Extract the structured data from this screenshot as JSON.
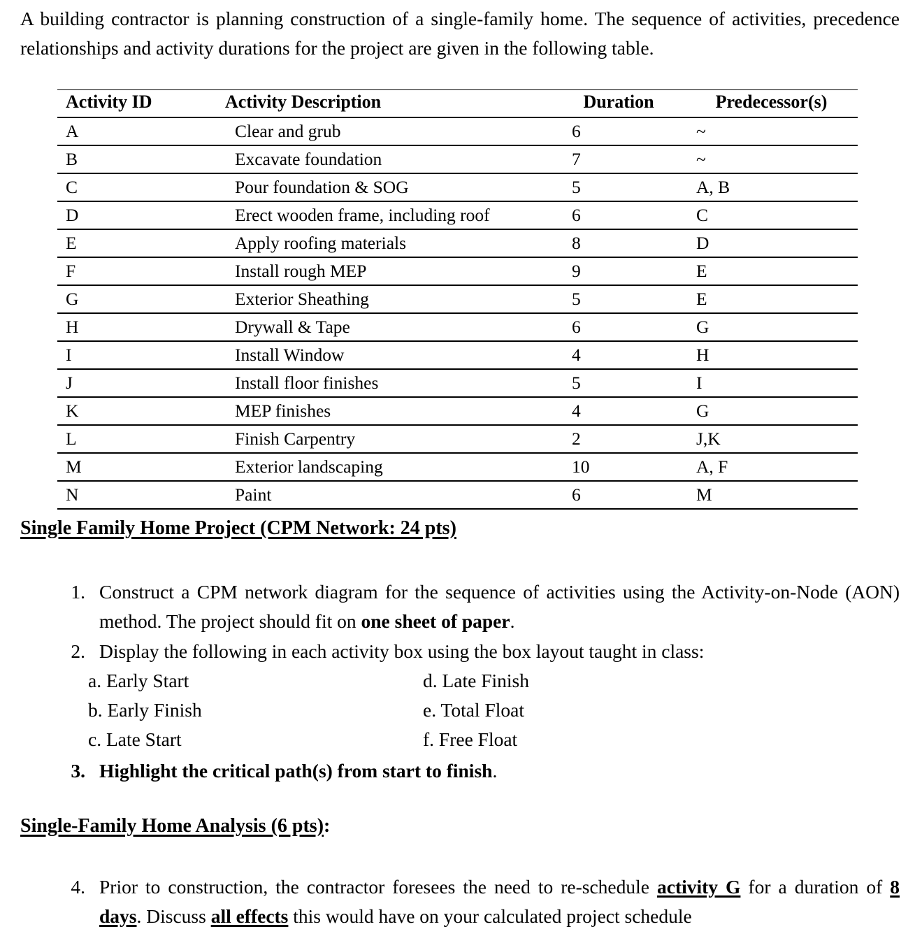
{
  "intro": {
    "paragraph": "A building contractor is planning construction of a single-family home.  The sequence of activities, precedence relationships and activity durations for the project are given in the following table."
  },
  "table": {
    "headers": {
      "id": "Activity ID",
      "description": "Activity Description",
      "duration": "Duration",
      "predecessors": "Predecessor(s)"
    },
    "rows": [
      {
        "id": "A",
        "description": "Clear and grub",
        "duration": "6",
        "predecessors": "~"
      },
      {
        "id": "B",
        "description": "Excavate foundation",
        "duration": "7",
        "predecessors": "~"
      },
      {
        "id": "C",
        "description": "Pour foundation & SOG",
        "duration": "5",
        "predecessors": "A, B"
      },
      {
        "id": "D",
        "description": "Erect wooden frame, including roof",
        "duration": "6",
        "predecessors": "C"
      },
      {
        "id": "E",
        "description": "Apply roofing materials",
        "duration": "8",
        "predecessors": "D"
      },
      {
        "id": "F",
        "description": "Install rough MEP",
        "duration": "9",
        "predecessors": "E"
      },
      {
        "id": "G",
        "description": "Exterior Sheathing",
        "duration": "5",
        "predecessors": "E"
      },
      {
        "id": "H",
        "description": "Drywall & Tape",
        "duration": "6",
        "predecessors": "G"
      },
      {
        "id": "I",
        "description": "Install Window",
        "duration": "4",
        "predecessors": "H"
      },
      {
        "id": "J",
        "description": "Install floor finishes",
        "duration": "5",
        "predecessors": "I"
      },
      {
        "id": "K",
        "description": "MEP finishes",
        "duration": "4",
        "predecessors": "G"
      },
      {
        "id": "L",
        "description": "Finish Carpentry",
        "duration": "2",
        "predecessors": "J,K"
      },
      {
        "id": "M",
        "description": "Exterior landscaping",
        "duration": "10",
        "predecessors": "A, F"
      },
      {
        "id": "N",
        "description": "Paint",
        "duration": "6",
        "predecessors": "M"
      }
    ]
  },
  "sections": {
    "project_heading": "Single Family Home Project (CPM Network: 24 pts)",
    "analysis_heading": "Single-Family Home Analysis (6 pts)",
    "analysis_heading_suffix": ":"
  },
  "items": {
    "item1": {
      "number": "1.",
      "text_a": "Construct a CPM network diagram for the sequence of activities using the Activity-on-Node (AON) method.  The project should fit on ",
      "bold_b": "one sheet of paper",
      "text_c": "."
    },
    "item2": {
      "number": "2.",
      "text": "Display the following in each activity box using the box layout taught in class:"
    },
    "item3": {
      "number": "3.",
      "bold_text": "Highlight the critical path(s) from start to finish",
      "text_end": "."
    },
    "item4": {
      "number": "4.",
      "text_a": "Prior to construction, the contractor foresees the need to re-schedule ",
      "bold_b": "activity G",
      "text_c": " for a duration of ",
      "bold_d": "8 days",
      "text_e": ".  Discuss ",
      "bold_f": "all effects",
      "text_g": " this would have on your calculated project schedule"
    }
  },
  "sublist": [
    {
      "left": "a. Early Start",
      "right": "d. Late Finish"
    },
    {
      "left": "b. Early Finish",
      "right": "e. Total Float"
    },
    {
      "left": "c. Late Start",
      "right": "f.  Free Float"
    }
  ]
}
